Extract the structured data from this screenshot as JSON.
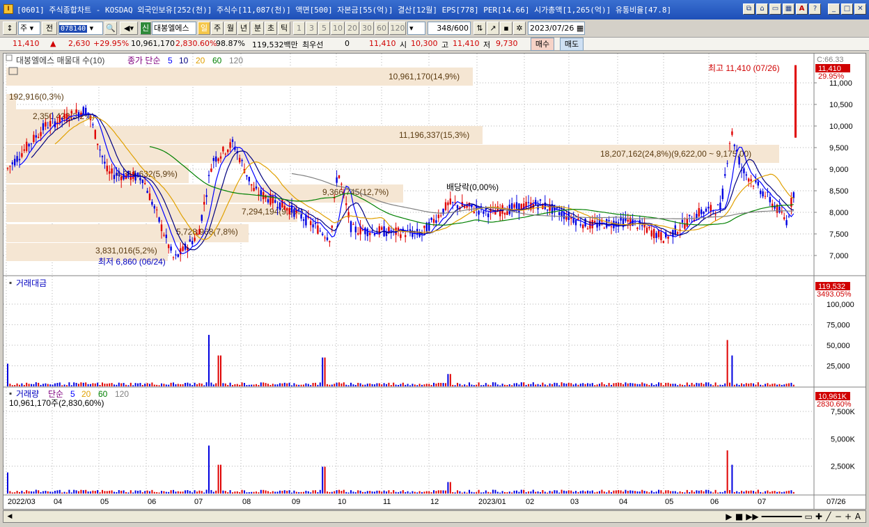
{
  "window": {
    "title": "[0601] 주식종합차트 - KOSDAQ 외국인보유[252(천)] 주식수[11,087(천)] 액면[500] 자본금[55(억)] 결산[12월] EPS[778] PER[14.66] 시가총액[1,265(억)] 유통비율[47.8]"
  },
  "toolbar": {
    "period_label": "주",
    "prev_label": "전",
    "code": "078140",
    "signal_label": "신",
    "stock_name": "대봉엘에스",
    "tf_day": "일",
    "tf_week": "주",
    "tf_month": "월",
    "tf_year": "년",
    "tf_min": "분",
    "tf_sec": "초",
    "tf_tick": "틱",
    "intervals": [
      "1",
      "3",
      "5",
      "10",
      "20",
      "30",
      "60",
      "120"
    ],
    "count": "348",
    "count_total": "/600",
    "date": "2023/07/26"
  },
  "quote": {
    "price": "11,410",
    "change": "2,630",
    "rate": "+29.95%",
    "volume": "10,961,170",
    "volume_rate": "2,830.60%",
    "ratio": "98.87%",
    "amount": "119,532백만",
    "best_label": "최우선",
    "best_value": "0",
    "ask": "11,410",
    "open_label": "시",
    "open": "10,300",
    "high_label": "고",
    "high": "11,410",
    "low_label": "저",
    "low": "9,730",
    "buy_label": "매수",
    "sell_label": "매도"
  },
  "price_panel": {
    "legend_name": "대봉엘에스 매물대 수(10)",
    "ma_label": "종가 단순",
    "ma_periods": [
      "5",
      "10",
      "20",
      "60",
      "120"
    ],
    "ma_colors": [
      "#0000ff",
      "#000080",
      "#e0a000",
      "#008000",
      "#808080"
    ],
    "c_label": "C:66.33",
    "last_price": "11,410",
    "last_rate": "29.95%",
    "high_marker": "최고 11,410 (07/26)",
    "low_marker": "최저 6,860 (06/24)",
    "dividend_marker": "배당락(0,00%)",
    "volume_profile": [
      "10,961,170(14,9%)",
      "192,916(0,3%)",
      "2,350,423(3,2%)",
      "11,196,337(15,3%)",
      "18,207,162(24,8%)(9,622,00 ~ 9,175,00)",
      "4,311,632(5,9%)",
      "9,366,745(12,7%)",
      "7,294,194(9,9%)",
      "5,728,968(7,8%)",
      "3,831,016(5,2%)"
    ],
    "y_ticks": [
      "11,000",
      "10,500",
      "10,000",
      "9,500",
      "9,000",
      "8,500",
      "8,000",
      "7,500",
      "7,000"
    ]
  },
  "amount_panel": {
    "label": "거래대금",
    "last_value": "119,532",
    "last_rate": "3493.05%",
    "y_ticks": [
      "100,000",
      "75,000",
      "50,000",
      "25,000"
    ]
  },
  "volume_panel": {
    "label": "거래량",
    "ma_label": "단순",
    "ma_periods": [
      "5",
      "20",
      "60",
      "120"
    ],
    "sub_label": "10,961,170주(2,830,60%)",
    "last_value": "10,961K",
    "last_rate": "2830.60%",
    "y_ticks": [
      "7,500K",
      "5,000K",
      "2,500K"
    ]
  },
  "x_axis": {
    "labels": [
      "2022/03",
      "04",
      "05",
      "06",
      "07",
      "08",
      "09",
      "10",
      "11",
      "12",
      "2023/01",
      "02",
      "03",
      "04",
      "05",
      "06",
      "07"
    ],
    "right_label": "07/26"
  },
  "colors": {
    "up": "#e00000",
    "down": "#0000e0",
    "profile_fill": "#f5e6d3",
    "profile_text": "#5a3a10",
    "highlight_red": "#d00000"
  }
}
